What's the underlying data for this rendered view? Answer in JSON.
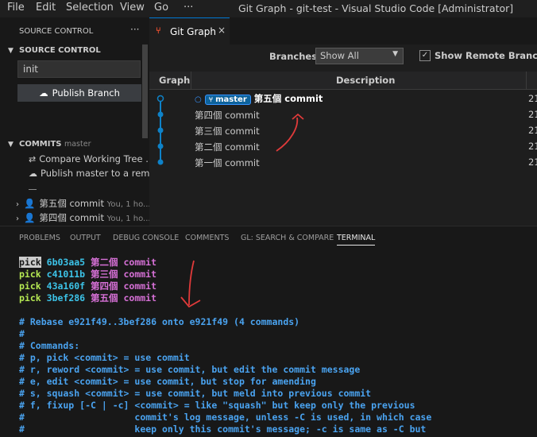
{
  "menu": [
    "File",
    "Edit",
    "Selection",
    "View",
    "Go",
    "···"
  ],
  "window_title": "Git Graph - git-test - Visual Studio Code [Administrator]",
  "sidebar": {
    "title": "SOURCE CONTROL",
    "more_icon": "···",
    "section_title": "SOURCE CONTROL",
    "commit_message": "init",
    "publish_label": "Publish Branch",
    "commits_title": "COMMITS",
    "commits_branch": "master",
    "items": [
      {
        "label": "Compare Working Tree ...",
        "icon": "compare-icon"
      },
      {
        "label": "Publish master to a rem...",
        "icon": "cloud-upload-icon"
      }
    ],
    "history": [
      {
        "label": "第五個 commit",
        "meta": "You, 1 ho..."
      },
      {
        "label": "第四個 commit",
        "meta": "You, 1 ho..."
      }
    ]
  },
  "tab": {
    "label": "Git Graph",
    "close": "×"
  },
  "toolbar": {
    "branches_label": "Branches:",
    "branch_value": "Show All",
    "remote_label": "Show Remote Branches",
    "remote_checked": "✓"
  },
  "graph_header": {
    "graph": "Graph",
    "description": "Description"
  },
  "commits": [
    {
      "message": "第五個 commit",
      "branch": "master",
      "date": "21",
      "head": true
    },
    {
      "message": "第四個 commit",
      "date": "21"
    },
    {
      "message": "第三個 commit",
      "date": "21"
    },
    {
      "message": "第二個 commit",
      "date": "21"
    },
    {
      "message": "第一個 commit",
      "date": "21"
    }
  ],
  "panel_tabs": [
    "PROBLEMS",
    "OUTPUT",
    "DEBUG CONSOLE",
    "COMMENTS",
    "GL: SEARCH & COMPARE",
    "TERMINAL"
  ],
  "terminal": {
    "picks": [
      {
        "cmd": "pick",
        "hash": "6b03aa5",
        "msg": "第二個 commit"
      },
      {
        "cmd": "pick",
        "hash": "c41011b",
        "msg": "第三個 commit"
      },
      {
        "cmd": "pick",
        "hash": "43a160f",
        "msg": "第四個 commit"
      },
      {
        "cmd": "pick",
        "hash": "3bef286",
        "msg": "第五個 commit"
      }
    ],
    "comments": [
      "# Rebase e921f49..3bef286 onto e921f49 (4 commands)",
      "#",
      "# Commands:",
      "# p, pick <commit> = use commit",
      "# r, reword <commit> = use commit, but edit the commit message",
      "# e, edit <commit> = use commit, but stop for amending",
      "# s, squash <commit> = use commit, but meld into previous commit",
      "# f, fixup [-C | -c] <commit> = like \"squash\" but keep only the previous",
      "#                    commit's log message, unless -C is used, in which case",
      "#                    keep only this commit's message; -c is same as -C but"
    ]
  },
  "colors": {
    "accent": "#0078d4",
    "graph_line": "#0e82c8",
    "annotation": "#e03a3a"
  }
}
